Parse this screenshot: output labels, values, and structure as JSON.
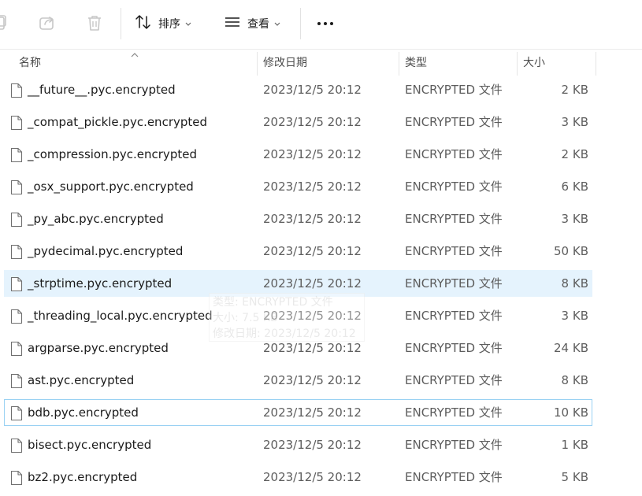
{
  "toolbar": {
    "sort_label": "排序",
    "view_label": "查看",
    "more_label": "•••"
  },
  "columns": {
    "name": "名称",
    "date": "修改日期",
    "type": "类型",
    "size": "大小"
  },
  "files": [
    {
      "name": "__future__.pyc.encrypted",
      "date": "2023/12/5 20:12",
      "type": "ENCRYPTED 文件",
      "size": "2 KB"
    },
    {
      "name": "_compat_pickle.pyc.encrypted",
      "date": "2023/12/5 20:12",
      "type": "ENCRYPTED 文件",
      "size": "3 KB"
    },
    {
      "name": "_compression.pyc.encrypted",
      "date": "2023/12/5 20:12",
      "type": "ENCRYPTED 文件",
      "size": "2 KB"
    },
    {
      "name": "_osx_support.pyc.encrypted",
      "date": "2023/12/5 20:12",
      "type": "ENCRYPTED 文件",
      "size": "6 KB"
    },
    {
      "name": "_py_abc.pyc.encrypted",
      "date": "2023/12/5 20:12",
      "type": "ENCRYPTED 文件",
      "size": "3 KB"
    },
    {
      "name": "_pydecimal.pyc.encrypted",
      "date": "2023/12/5 20:12",
      "type": "ENCRYPTED 文件",
      "size": "50 KB"
    },
    {
      "name": "_strptime.pyc.encrypted",
      "date": "2023/12/5 20:12",
      "type": "ENCRYPTED 文件",
      "size": "8 KB"
    },
    {
      "name": "_threading_local.pyc.encrypted",
      "date": "2023/12/5 20:12",
      "type": "ENCRYPTED 文件",
      "size": "3 KB"
    },
    {
      "name": "argparse.pyc.encrypted",
      "date": "2023/12/5 20:12",
      "type": "ENCRYPTED 文件",
      "size": "24 KB"
    },
    {
      "name": "ast.pyc.encrypted",
      "date": "2023/12/5 20:12",
      "type": "ENCRYPTED 文件",
      "size": "8 KB"
    },
    {
      "name": "bdb.pyc.encrypted",
      "date": "2023/12/5 20:12",
      "type": "ENCRYPTED 文件",
      "size": "10 KB"
    },
    {
      "name": "bisect.pyc.encrypted",
      "date": "2023/12/5 20:12",
      "type": "ENCRYPTED 文件",
      "size": "1 KB"
    },
    {
      "name": "bz2.pyc.encrypted",
      "date": "2023/12/5 20:12",
      "type": "ENCRYPTED 文件",
      "size": "5 KB"
    }
  ],
  "hovered_row": "_strptime.pyc.encrypted",
  "focused_row": "bdb.pyc.encrypted",
  "tooltip": {
    "type_line": "类型: ENCRYPTED 文件",
    "size_line": "大小: 7.5 KB",
    "date_line": "修改日期: 2023/12/5 20:12"
  },
  "colors": {
    "hover_bg": "#e5f3fd",
    "focus_border": "#99d1f3",
    "disabled_icon": "#c7c7c7"
  }
}
